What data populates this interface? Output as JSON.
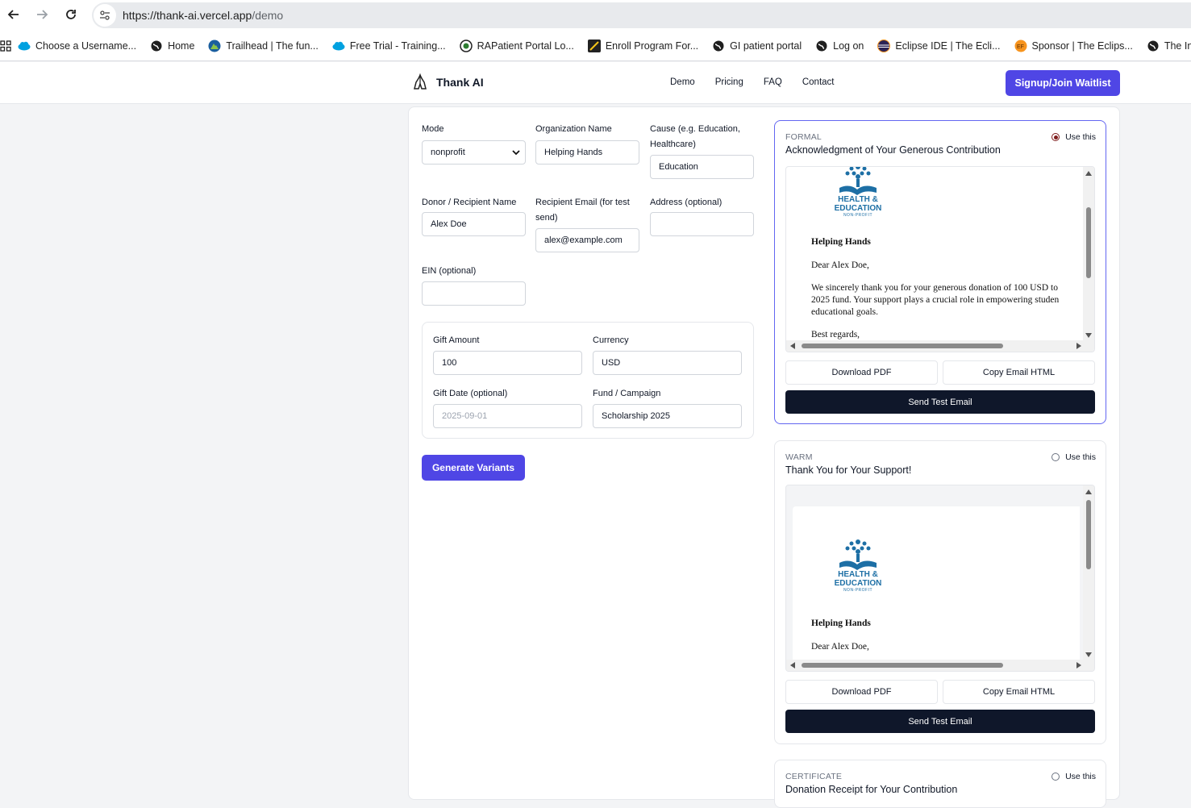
{
  "browser": {
    "url_host": "https://thank-ai.vercel.app",
    "url_path": "/demo",
    "bookmarks": [
      {
        "label": "Choose a Username...",
        "icon": "salesforce-cloud-icon"
      },
      {
        "label": "Home",
        "icon": "globe-icon"
      },
      {
        "label": "Trailhead | The fun...",
        "icon": "trailhead-icon"
      },
      {
        "label": "Free Trial - Training...",
        "icon": "salesforce-cloud-icon"
      },
      {
        "label": "RAPatient Portal Lo...",
        "icon": "portal-icon"
      },
      {
        "label": "Enroll Program For...",
        "icon": "enroll-icon"
      },
      {
        "label": "GI patient portal",
        "icon": "globe-icon"
      },
      {
        "label": "Log on",
        "icon": "globe-icon"
      },
      {
        "label": "Eclipse IDE | The Ecli...",
        "icon": "eclipse-icon"
      },
      {
        "label": "Sponsor | The Eclips...",
        "icon": "sponsor-icon"
      },
      {
        "label": "The Intern",
        "icon": "globe-icon"
      }
    ]
  },
  "header": {
    "brand": "Thank AI",
    "nav": [
      "Demo",
      "Pricing",
      "FAQ",
      "Contact"
    ],
    "cta": "Signup/Join Waitlist"
  },
  "form": {
    "mode": {
      "label": "Mode",
      "value": "nonprofit"
    },
    "org_name": {
      "label": "Organization Name",
      "value": "Helping Hands"
    },
    "cause": {
      "label": "Cause (e.g. Education, Healthcare)",
      "value": "Education"
    },
    "donor": {
      "label": "Donor / Recipient Name",
      "value": "Alex Doe"
    },
    "email": {
      "label": "Recipient Email (for test send)",
      "value": "alex@example.com"
    },
    "address": {
      "label": "Address (optional)",
      "value": ""
    },
    "ein": {
      "label": "EIN (optional)",
      "value": ""
    },
    "gift_amount": {
      "label": "Gift Amount",
      "value": "100"
    },
    "currency": {
      "label": "Currency",
      "value": "USD"
    },
    "gift_date": {
      "label": "Gift Date (optional)",
      "placeholder": "2025-09-01"
    },
    "fund": {
      "label": "Fund / Campaign",
      "value": "Scholarship 2025"
    },
    "generate": "Generate Variants"
  },
  "logo_text": {
    "line1": "HEALTH &",
    "line2": "EDUCATION",
    "line3": "NON-PROFIT"
  },
  "variants": [
    {
      "kind": "FORMAL",
      "subject": "Acknowledgment of Your Generous Contribution",
      "use_label": "Use this",
      "selected": true,
      "org": "Helping Hands",
      "greeting": "Dear Alex Doe,",
      "body1": "We sincerely thank you for your generous donation of 100 USD to",
      "body2": "2025 fund. Your support plays a crucial role in empowering studen",
      "body3": "educational goals.",
      "closing": "Best regards,",
      "download": "Download PDF",
      "copy": "Copy Email HTML",
      "send": "Send Test Email"
    },
    {
      "kind": "WARM",
      "subject": "Thank You for Your Support!",
      "use_label": "Use this",
      "selected": false,
      "org": "Helping Hands",
      "greeting": "Dear Alex Doe,",
      "download": "Download PDF",
      "copy": "Copy Email HTML",
      "send": "Send Test Email"
    },
    {
      "kind": "CERTIFICATE",
      "subject": "Donation Receipt for Your Contribution",
      "use_label": "Use this",
      "selected": false
    }
  ],
  "colors": {
    "accent": "#4f46e5",
    "dark_button": "#0f172a",
    "logo_blue": "#1d6fa5"
  }
}
